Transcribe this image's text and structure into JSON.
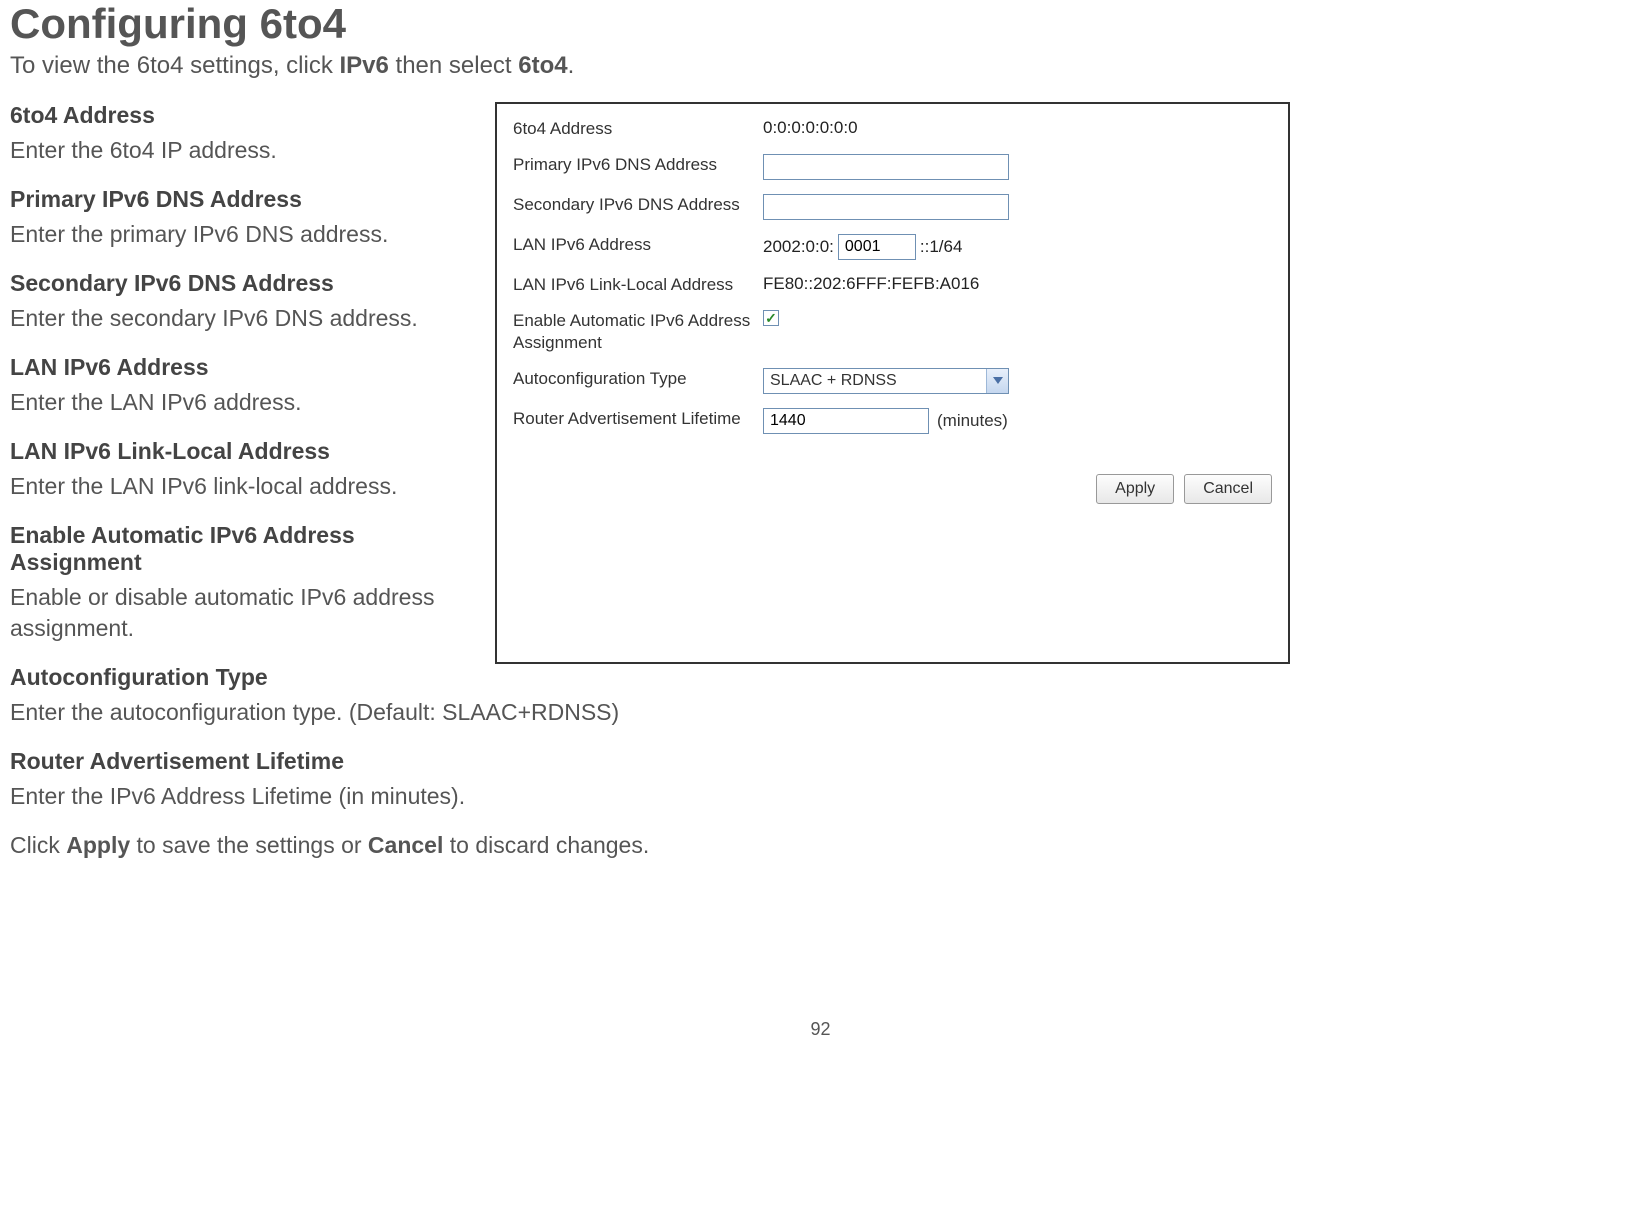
{
  "title": "Configuring 6to4",
  "subtitle_pre": "To view the 6to4 settings, click ",
  "subtitle_bold1": "IPv6",
  "subtitle_mid": " then select ",
  "subtitle_bold2": "6to4",
  "subtitle_end": ".",
  "sections": [
    {
      "title": "6to4 Address",
      "desc": "Enter the 6to4 IP address."
    },
    {
      "title": "Primary IPv6 DNS Address",
      "desc": "Enter the primary IPv6 DNS address."
    },
    {
      "title": "Secondary IPv6 DNS Address",
      "desc": "Enter the secondary IPv6 DNS address."
    },
    {
      "title": "LAN IPv6 Address",
      "desc": "Enter the LAN IPv6 address."
    },
    {
      "title": "LAN IPv6 Link-Local Address",
      "desc": "Enter the LAN IPv6 link-local address."
    },
    {
      "title": "Enable Automatic IPv6 Address Assignment",
      "desc": "Enable or disable automatic IPv6 address assignment."
    },
    {
      "title": "Autoconfiguration Type",
      "desc": "Enter the autoconfiguration type. (Default: SLAAC+RDNSS)"
    },
    {
      "title": "Router Advertisement Lifetime",
      "desc": "Enter the IPv6 Address Lifetime (in minutes)."
    }
  ],
  "final_pre": "Click ",
  "final_b1": "Apply",
  "final_mid": " to save the settings or ",
  "final_b2": "Cancel",
  "final_end": " to discard changes.",
  "form": {
    "sixto4_label": "6to4 Address",
    "sixto4_value": "0:0:0:0:0:0:0",
    "primary_dns_label": "Primary IPv6 DNS Address",
    "primary_dns_value": "",
    "secondary_dns_label": "Secondary IPv6 DNS Address",
    "secondary_dns_value": "",
    "lan_ipv6_label": "LAN IPv6 Address",
    "lan_prefix": "2002:0:0:",
    "lan_input": "0001",
    "lan_suffix": "::1/64",
    "linklocal_label": "LAN IPv6 Link-Local Address",
    "linklocal_value": "FE80::202:6FFF:FEFB:A016",
    "enable_auto_label": "Enable Automatic IPv6 Address Assignment",
    "enable_auto_checked": "✓",
    "autoconf_label": "Autoconfiguration Type",
    "autoconf_value": "SLAAC + RDNSS",
    "router_adv_label": "Router Advertisement Lifetime",
    "router_adv_value": "1440",
    "router_adv_unit": "(minutes)",
    "apply_label": "Apply",
    "cancel_label": "Cancel"
  },
  "page_number": "92"
}
